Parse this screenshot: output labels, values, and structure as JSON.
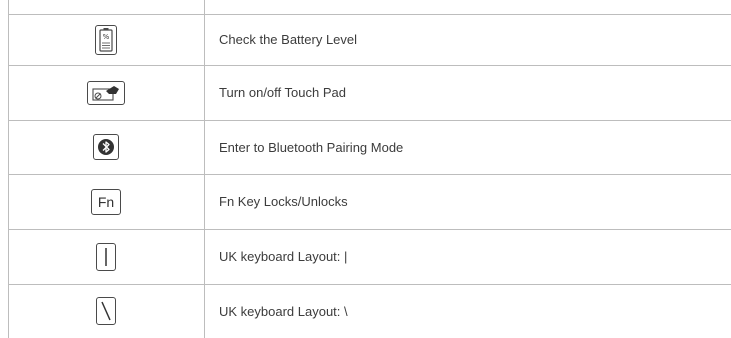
{
  "rows": [
    {
      "icon": "battery-level-icon",
      "label": "Check the Battery Level",
      "key_text": "%"
    },
    {
      "icon": "touchpad-toggle-icon",
      "label": "Turn on/off Touch Pad",
      "key_text": ""
    },
    {
      "icon": "bluetooth-icon",
      "label": "Enter to Bluetooth Pairing Mode",
      "key_text": ""
    },
    {
      "icon": "fn-key-icon",
      "label": "Fn Key Locks/Unlocks",
      "key_text": "Fn"
    },
    {
      "icon": "pipe-key-icon",
      "label": "UK keyboard Layout: |",
      "key_text": "|"
    },
    {
      "icon": "backslash-key-icon",
      "label": "UK keyboard Layout: \\",
      "key_text": "\\"
    }
  ]
}
